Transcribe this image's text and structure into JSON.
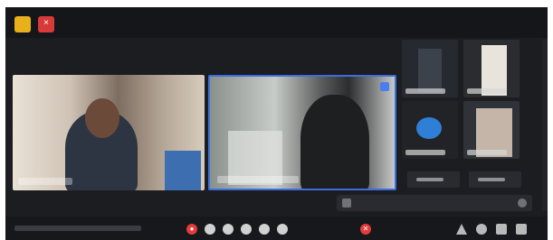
{
  "window": {
    "controls": [
      {
        "icon": "minimize-icon",
        "glyph": "",
        "color": "#e8b11c"
      },
      {
        "icon": "close-icon",
        "glyph": "×",
        "color": "#d83a3a"
      }
    ]
  },
  "video": {
    "tiles_main": [
      {
        "name": "",
        "pinned": false
      },
      {
        "name": "",
        "pinned": true
      }
    ],
    "tiles_small": [
      {
        "name": ""
      },
      {
        "name": ""
      },
      {
        "name": ""
      },
      {
        "name": ""
      }
    ]
  },
  "chat": {
    "placeholder": ""
  },
  "toolbar": {
    "buttons": [
      {
        "icon": "record-icon",
        "glyph": "●",
        "color": "#e43b3b"
      },
      {
        "icon": "mic-icon",
        "glyph": ""
      },
      {
        "icon": "camera-icon",
        "glyph": ""
      },
      {
        "icon": "share-screen-icon",
        "glyph": ""
      },
      {
        "icon": "participants-icon",
        "glyph": ""
      },
      {
        "icon": "more-icon",
        "glyph": ""
      },
      {
        "icon": "end-call-icon",
        "glyph": "✕",
        "color": "#e43b3b"
      }
    ],
    "right_icons": [
      {
        "icon": "warning-icon"
      },
      {
        "icon": "settings-icon"
      },
      {
        "icon": "grid-icon"
      },
      {
        "icon": "fullscreen-icon"
      }
    ]
  },
  "colors": {
    "background": "#1c1d21",
    "accent": "#3b6fe0",
    "danger": "#e43b3b",
    "warning": "#e8b11c"
  }
}
